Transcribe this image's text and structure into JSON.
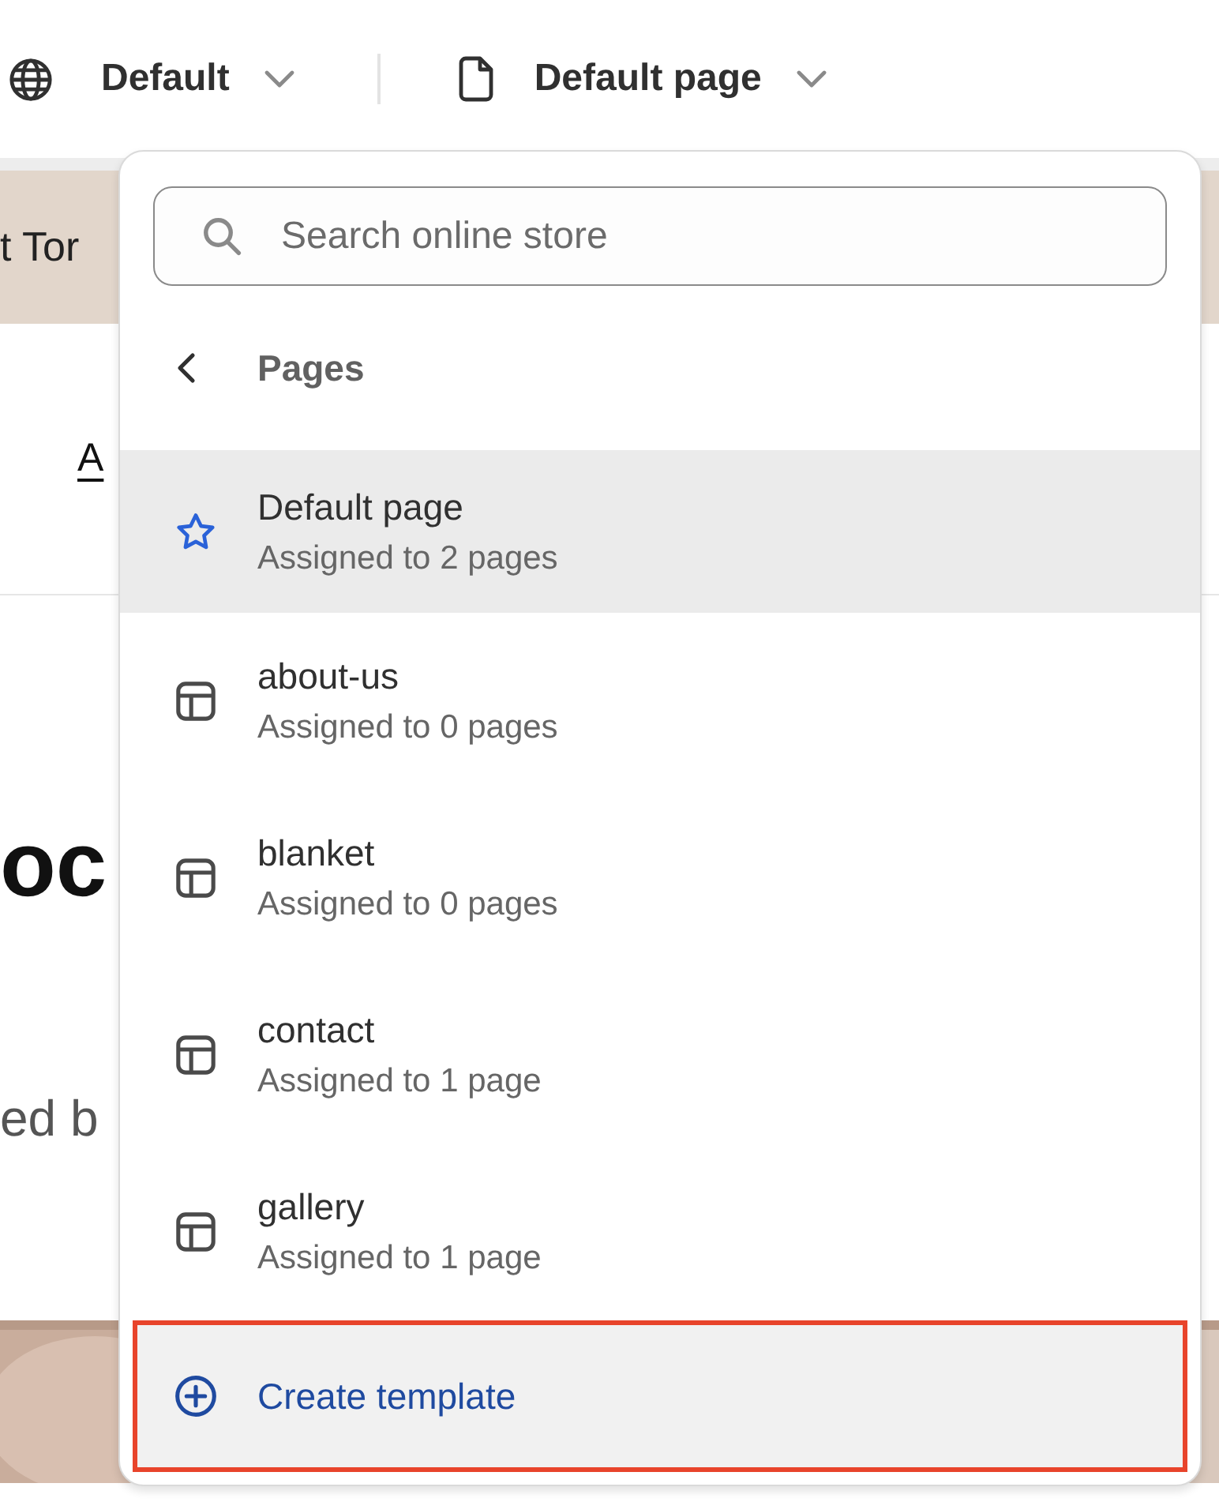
{
  "toolbar": {
    "theme_selector": {
      "label": "Default"
    },
    "template_selector": {
      "label": "Default page"
    }
  },
  "background_page": {
    "banner_text": "t Tor",
    "nav_link": "A",
    "heading": "oc",
    "subheading": "ed b"
  },
  "dropdown": {
    "search": {
      "placeholder": "Search online store"
    },
    "header": "Pages",
    "templates": [
      {
        "name": "Default page",
        "assigned": "Assigned to 2 pages",
        "kind": "default",
        "selected": true
      },
      {
        "name": "about-us",
        "assigned": "Assigned to 0 pages",
        "kind": "layout",
        "selected": false
      },
      {
        "name": "blanket",
        "assigned": "Assigned to 0 pages",
        "kind": "layout",
        "selected": false
      },
      {
        "name": "contact",
        "assigned": "Assigned to 1 page",
        "kind": "layout",
        "selected": false
      },
      {
        "name": "gallery",
        "assigned": "Assigned to 1 page",
        "kind": "layout",
        "selected": false
      }
    ],
    "create_button": {
      "label": "Create template",
      "highlighted": true
    }
  }
}
